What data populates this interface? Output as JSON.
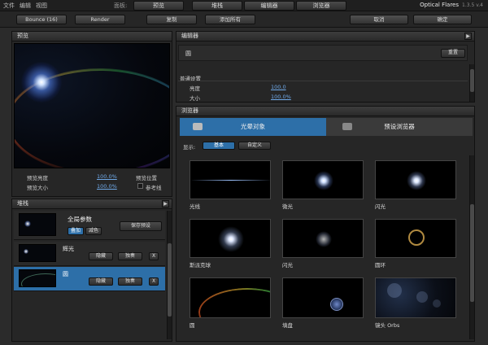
{
  "menu": {
    "items": [
      "文件",
      "编辑",
      "视图"
    ],
    "panels_label": "面板:"
  },
  "panel_tabs": [
    "预览",
    "堆栈",
    "编辑器",
    "浏览器"
  ],
  "brand": {
    "name": "Optical Flares",
    "version": "1.3.5 v.4"
  },
  "toolbar": {
    "bounce_label": "Bounce (16)",
    "render_label": "Render",
    "copy_label": "复制",
    "add_all_label": "添加所有",
    "cancel_label": "取消",
    "ok_label": "确定"
  },
  "preview": {
    "title": "预览",
    "brightness_label": "预览亮度",
    "brightness_value": "100.0%",
    "size_label": "预览大小",
    "size_value": "100.0%",
    "position_label": "预览位置",
    "reference_label": "参考线"
  },
  "stack": {
    "title": "堆栈",
    "global_label": "全局参数",
    "add_mode": "叠加",
    "color_mode": "减色",
    "save_preset": "保存预设",
    "layers": [
      {
        "name": "辉光",
        "hide": "隐藏",
        "solo": "独奏",
        "x": "X"
      },
      {
        "name": "圆",
        "hide": "隐藏",
        "solo": "独奏",
        "x": "X"
      }
    ]
  },
  "editor": {
    "title": "编辑器",
    "object_name": "圆",
    "reset_label": "重置",
    "section_label": "普通设置",
    "brightness_label": "亮度",
    "brightness_value": "100.0",
    "size_label": "大小",
    "size_value": "100.0%"
  },
  "browser": {
    "title": "浏览器",
    "tab_lens_objects": "光晕对象",
    "tab_preset_browser": "预设浏览器",
    "show_label": "显示:",
    "filter_basic": "基本",
    "filter_custom": "自定义",
    "items": [
      "光线",
      "微光",
      "闪光",
      "斯派克球",
      "闪光",
      "圆环",
      "圆",
      "填盘",
      "镜头 Orbs"
    ]
  },
  "colors": {
    "accent": "#2d6fa8",
    "link": "#6fa9e8",
    "bg": "#262626"
  }
}
